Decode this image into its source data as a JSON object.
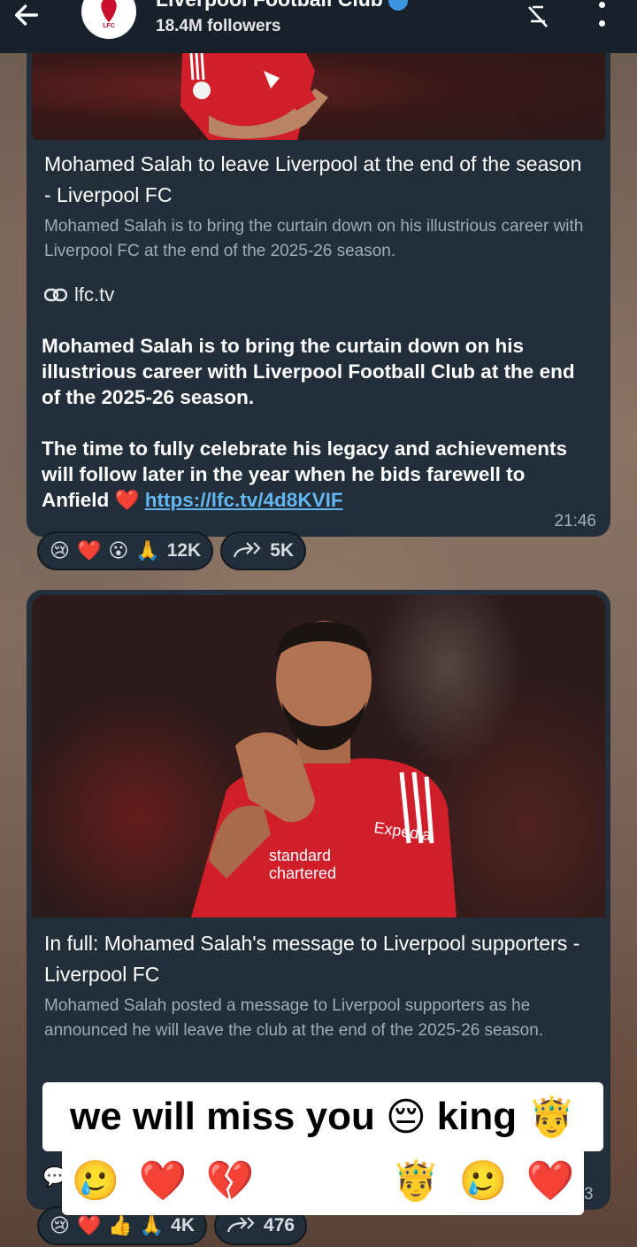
{
  "header": {
    "channel_name": "Liverpool Football Club",
    "followers": "18.4M followers",
    "avatar_text": "LFC"
  },
  "post1": {
    "preview_title": "Mohamed Salah to leave Liverpool at the end of the season - Liverpool FC",
    "preview_desc": "Mohamed Salah is to bring the curtain down on his illustrious career with Liverpool FC at the end of the 2025-26 season.",
    "link_domain": "lfc.tv",
    "paragraph1": "Mohamed Salah is to bring the curtain down on his illustrious career with Liverpool Football Club at the end of the 2025-26 season.",
    "paragraph2_prefix": "The time to fully celebrate his legacy and achievements will follow later in the year when he bids farewell to Anfield",
    "heart_emoji": "❤️",
    "link_url": "https://lfc.tv/4d8KVIF",
    "time": "21:46",
    "reactions": {
      "emojis": [
        "😢",
        "❤️",
        "😮",
        "🙏"
      ],
      "count": "12K",
      "forwards": "5K"
    }
  },
  "post2": {
    "preview_title": "In full: Mohamed Salah's message to Liverpool supporters - Liverpool FC",
    "preview_desc": "Mohamed Salah posted a message to Liverpool supporters as he announced he will leave the club at the end of the 2025-26 season.",
    "time": "3",
    "reactions": {
      "emojis": [
        "😢",
        "❤️",
        "👍",
        "🙏"
      ],
      "count": "4K",
      "forwards": "476"
    }
  },
  "overlay": {
    "line1_text": "we will miss you",
    "line1_emoji1": "😔",
    "line1_word": "king",
    "line1_emoji2": "🤴",
    "line2_emojis": [
      "🥲",
      "❤️",
      "💔",
      "😔",
      "😪",
      "🤴",
      "🥲",
      "❤️"
    ]
  },
  "colors": {
    "header_bg": "#17212b",
    "card_bg": "#222e3a",
    "link": "#63b6f0",
    "verified": "#3d95e0"
  }
}
